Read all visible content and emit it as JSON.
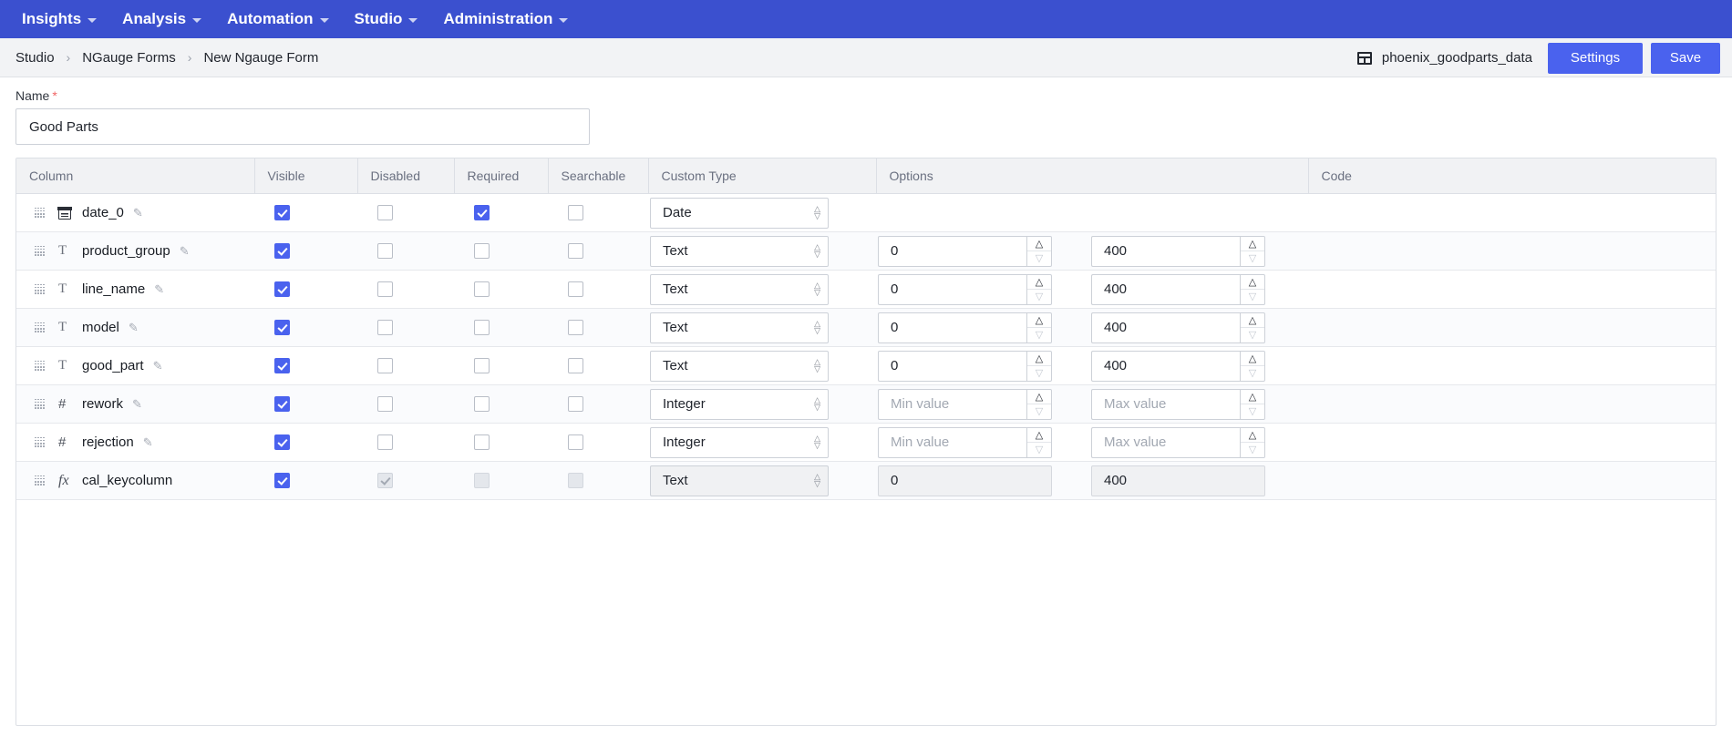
{
  "navbar": {
    "items": [
      {
        "label": "Insights",
        "caret": true
      },
      {
        "label": "Analysis",
        "caret": true
      },
      {
        "label": "Automation",
        "caret": true
      },
      {
        "label": "Studio",
        "caret": true
      },
      {
        "label": "Administration",
        "caret": true
      }
    ],
    "color": "#3b50cf"
  },
  "breadcrumb": {
    "items": [
      "Studio",
      "NGauge Forms",
      "New Ngauge Form"
    ],
    "separator": "›"
  },
  "header": {
    "dataset_name": "phoenix_goodparts_data",
    "dataset_icon": "table-icon",
    "settings_label": "Settings",
    "save_label": "Save",
    "accent": "#4a62ee"
  },
  "name_field": {
    "label": "Name",
    "required_marker": "*",
    "value": "Good Parts",
    "placeholder": ""
  },
  "table": {
    "headers": [
      "Column",
      "Visible",
      "Disabled",
      "Required",
      "Searchable",
      "Custom Type",
      "Options",
      "Code"
    ],
    "rows": [
      {
        "column": "date_0",
        "type_icon": "calendar-icon",
        "type_glyph": "",
        "editable": true,
        "visible": true,
        "disabled": false,
        "required": true,
        "searchable": false,
        "custom_type": "Date",
        "opt1": null,
        "opt1_placeholder": "",
        "opt2": null,
        "opt2_placeholder": "",
        "code": "",
        "locked": false
      },
      {
        "column": "product_group",
        "type_icon": "text-icon",
        "type_glyph": "T",
        "editable": true,
        "visible": true,
        "disabled": false,
        "required": false,
        "searchable": false,
        "custom_type": "Text",
        "opt1": "0",
        "opt1_placeholder": "",
        "opt2": "400",
        "opt2_placeholder": "",
        "code": "",
        "locked": false
      },
      {
        "column": "line_name",
        "type_icon": "text-icon",
        "type_glyph": "T",
        "editable": true,
        "visible": true,
        "disabled": false,
        "required": false,
        "searchable": false,
        "custom_type": "Text",
        "opt1": "0",
        "opt1_placeholder": "",
        "opt2": "400",
        "opt2_placeholder": "",
        "code": "",
        "locked": false
      },
      {
        "column": "model",
        "type_icon": "text-icon",
        "type_glyph": "T",
        "editable": true,
        "visible": true,
        "disabled": false,
        "required": false,
        "searchable": false,
        "custom_type": "Text",
        "opt1": "0",
        "opt1_placeholder": "",
        "opt2": "400",
        "opt2_placeholder": "",
        "code": "",
        "locked": false
      },
      {
        "column": "good_part",
        "type_icon": "text-icon",
        "type_glyph": "T",
        "editable": true,
        "visible": true,
        "disabled": false,
        "required": false,
        "searchable": false,
        "custom_type": "Text",
        "opt1": "0",
        "opt1_placeholder": "",
        "opt2": "400",
        "opt2_placeholder": "",
        "code": "",
        "locked": false
      },
      {
        "column": "rework",
        "type_icon": "number-icon",
        "type_glyph": "#",
        "editable": true,
        "visible": true,
        "disabled": false,
        "required": false,
        "searchable": false,
        "custom_type": "Integer",
        "opt1": null,
        "opt1_placeholder": "Min value",
        "opt2": null,
        "opt2_placeholder": "Max value",
        "code": "",
        "locked": false
      },
      {
        "column": "rejection",
        "type_icon": "number-icon",
        "type_glyph": "#",
        "editable": true,
        "visible": true,
        "disabled": false,
        "required": false,
        "searchable": false,
        "custom_type": "Integer",
        "opt1": null,
        "opt1_placeholder": "Min value",
        "opt2": null,
        "opt2_placeholder": "Max value",
        "code": "",
        "locked": false
      },
      {
        "column": "cal_keycolumn",
        "type_icon": "function-icon",
        "type_glyph": "fx",
        "editable": false,
        "visible": true,
        "disabled": true,
        "required": false,
        "searchable": false,
        "custom_type": "Text",
        "opt1": "0",
        "opt1_placeholder": "",
        "opt2": "400",
        "opt2_placeholder": "",
        "code": "",
        "locked": true
      }
    ]
  }
}
